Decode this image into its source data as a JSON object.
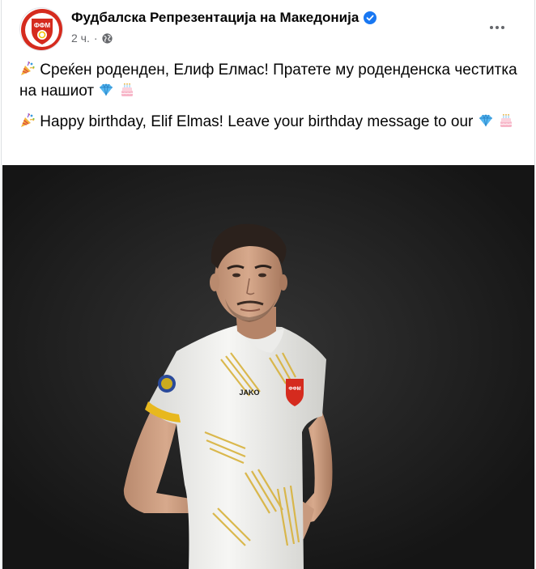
{
  "post": {
    "page_name": "Фудбалска Репрезентација на Македонија",
    "timestamp": "2 ч.",
    "separator": "·",
    "audience_icon": "globe-icon",
    "paragraph_mk": "Среќен роденден, Елиф Елмас! Пратете му роденденска честитка на нашиот",
    "paragraph_en": "Happy birthday, Elif Elmas! Leave your birthday message to our",
    "emojis": [
      "party-popper-icon",
      "gem-icon",
      "birthday-cake-icon"
    ]
  },
  "logo": {
    "text": "ФФМ"
  },
  "photo": {
    "jersey_brand": "JAKO",
    "crest_text": "ФФМ"
  },
  "colors": {
    "verified": "#1877f2",
    "shirt": "#f4f4f2",
    "gold": "#d8b23c",
    "red": "#d52b1e"
  }
}
